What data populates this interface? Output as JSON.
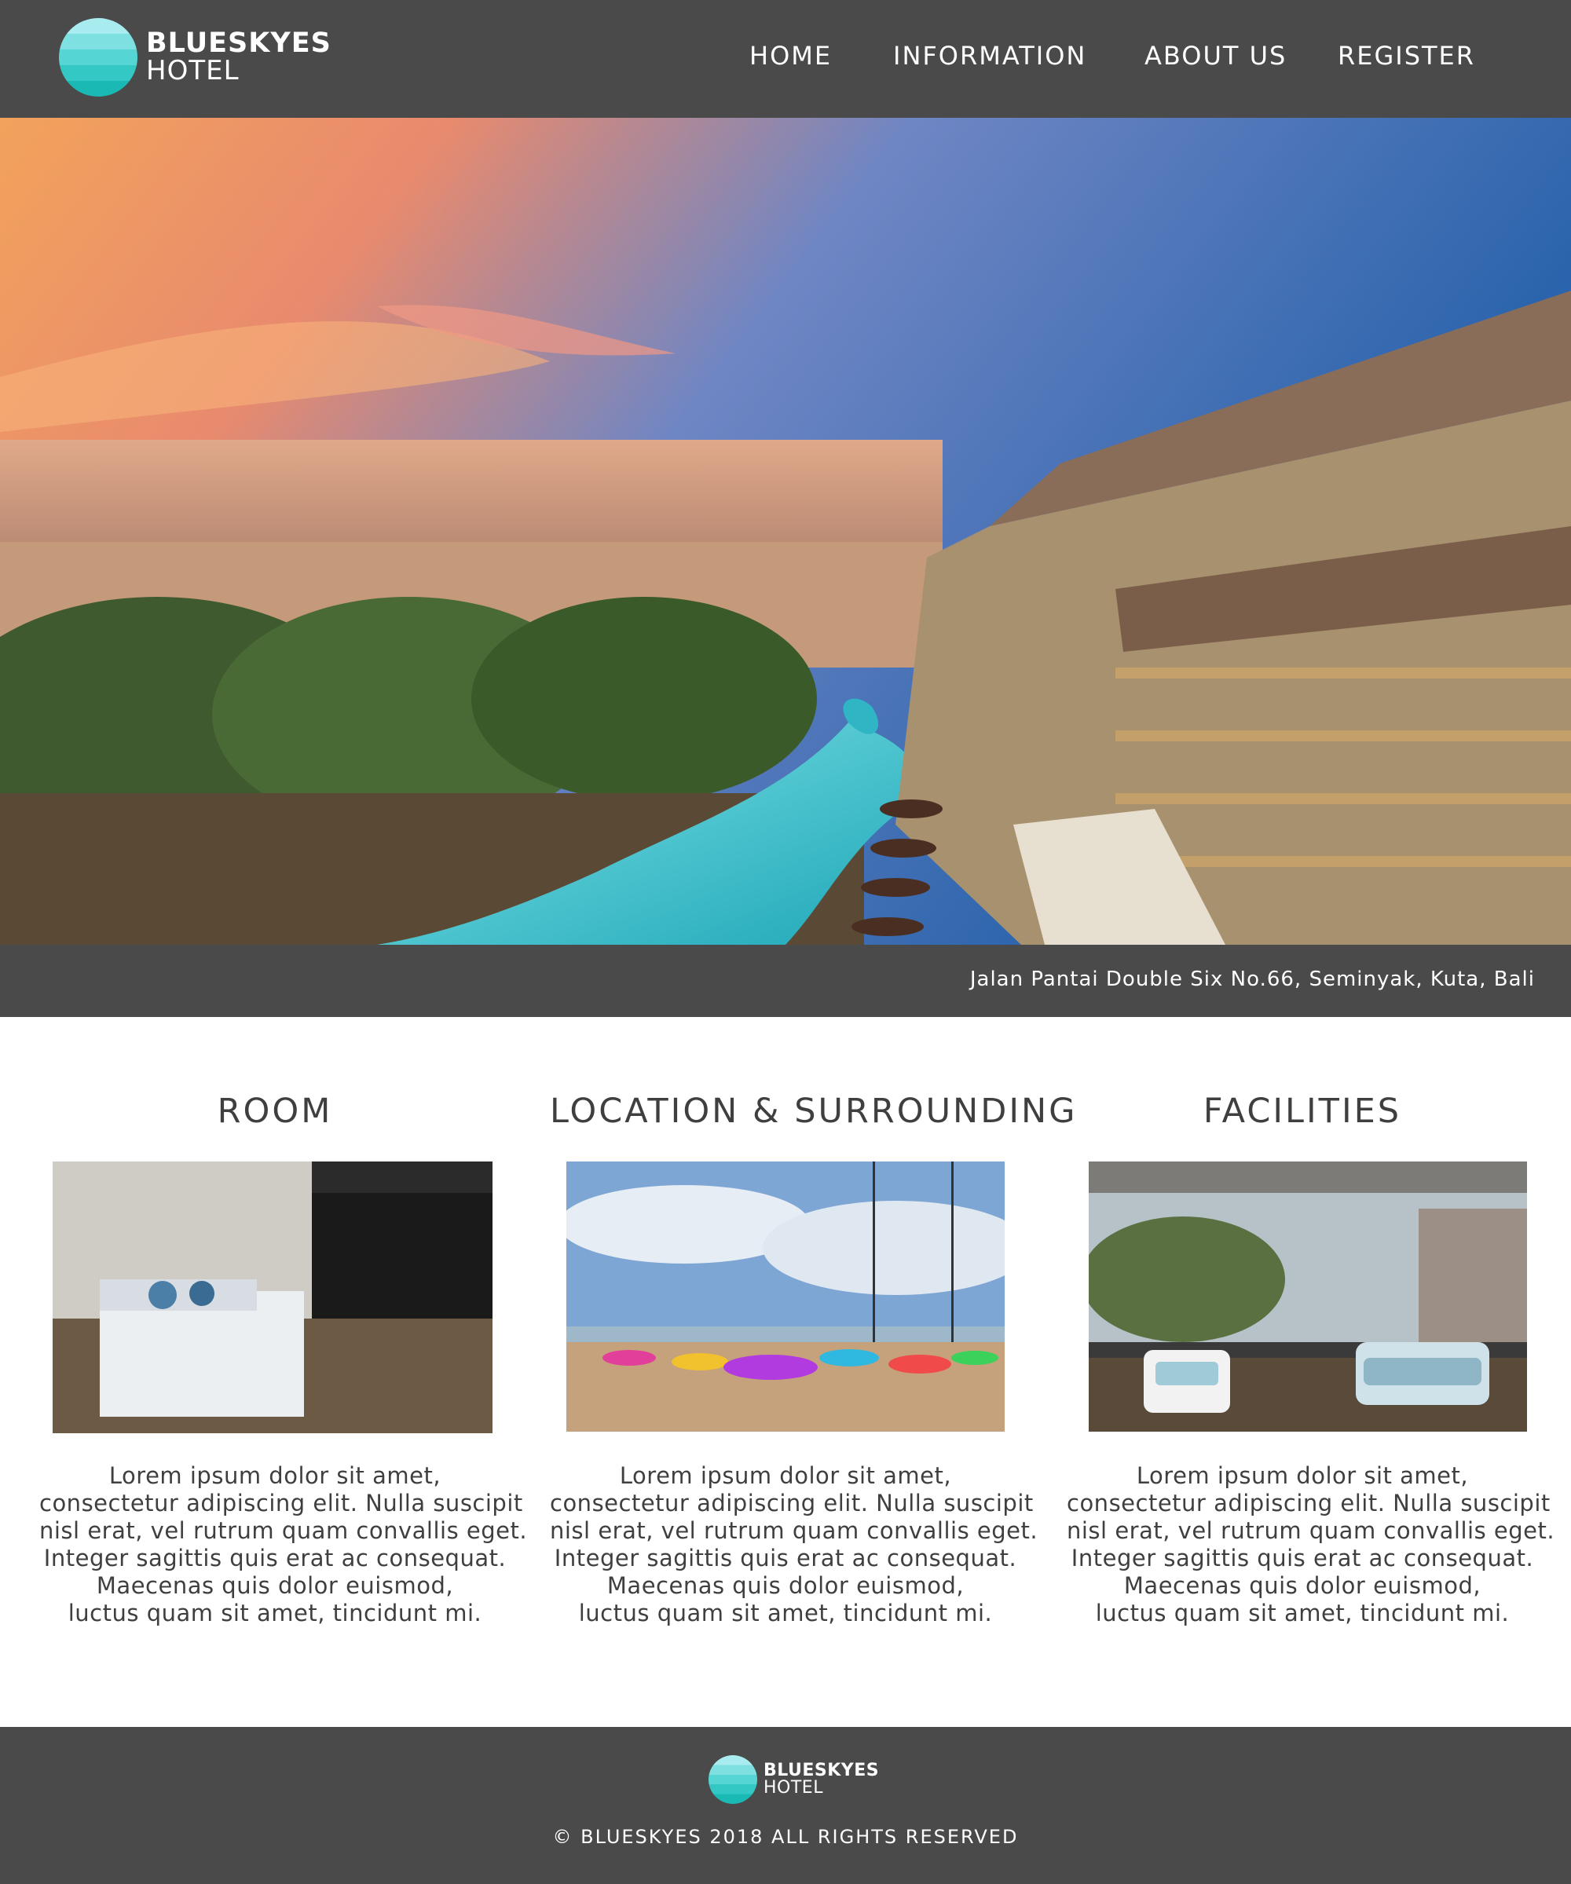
{
  "brand": {
    "line1": "BLUESKYES",
    "line2": "HOTEL"
  },
  "nav": {
    "items": [
      {
        "label": "HOME"
      },
      {
        "label": "INFORMATION"
      },
      {
        "label": "ABOUT US"
      },
      {
        "label": "REGISTER"
      }
    ]
  },
  "hero": {
    "image": "resort-sunset-beach-pool-photo",
    "address": "Jalan Pantai Double Six No.66, Seminyak, Kuta, Bali"
  },
  "features": [
    {
      "title": "ROOM",
      "image": "hotel-bedroom-photo",
      "lines": [
        "Lorem ipsum dolor sit amet,",
        "consectetur adipiscing elit. Nulla suscipit",
        "nisl erat, vel rutrum quam convallis eget.",
        "Integer sagittis quis erat ac consequat.",
        "Maecenas quis dolor euismod,",
        "luctus quam sit amet, tincidunt mi."
      ]
    },
    {
      "title": "LOCATION & SURROUNDING",
      "image": "beach-umbrellas-photo",
      "lines": [
        "Lorem ipsum dolor sit amet,",
        "consectetur adipiscing elit. Nulla suscipit",
        "nisl erat, vel rutrum quam convallis eget.",
        "Integer sagittis quis erat ac consequat.",
        "Maecenas quis dolor euismod,",
        "luctus quam sit amet, tincidunt mi."
      ]
    },
    {
      "title": "FACILITIES",
      "image": "balcony-lounge-photo",
      "lines": [
        "Lorem ipsum dolor sit amet,",
        "consectetur adipiscing elit. Nulla suscipit",
        "nisl erat, vel rutrum quam convallis eget.",
        "Integer sagittis quis erat ac consequat.",
        "Maecenas quis dolor euismod,",
        "luctus quam sit amet, tincidunt mi."
      ]
    }
  ],
  "footer": {
    "brand_line1": "BLUESKYES",
    "brand_line2": "HOTEL",
    "copyright": "© BLUESKYES 2018 ALL RIGHTS RESERVED"
  },
  "colors": {
    "bar": "#4a4a4a",
    "text": "#3f3f3f",
    "logo_teal": "#34c8c4"
  }
}
